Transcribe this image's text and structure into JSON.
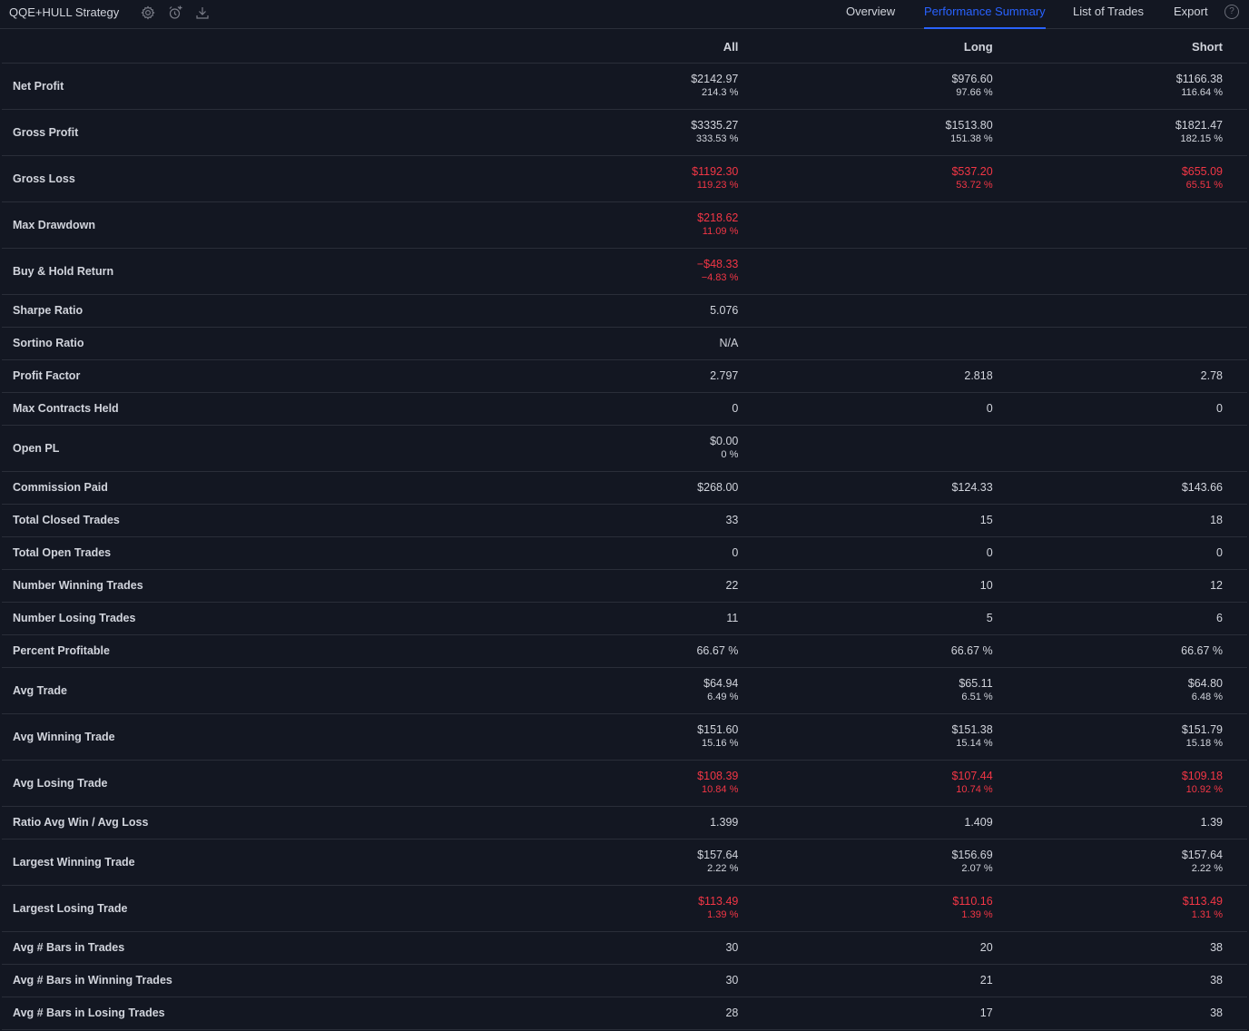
{
  "app": {
    "title": "QQE+HULL Strategy",
    "icons": [
      "gear-icon",
      "alarm-add-icon",
      "download-icon"
    ]
  },
  "tabs": [
    "Overview",
    "Performance Summary",
    "List of Trades",
    "Export"
  ],
  "active_tab": "Performance Summary",
  "help_glyph": "?",
  "colors": {
    "background": "#131722",
    "accent": "#2962ff",
    "negative": "#f23645",
    "text": "#d1d4dc",
    "divider": "#2a2e39"
  },
  "table": {
    "columns": [
      "All",
      "Long",
      "Short"
    ],
    "rows": [
      {
        "label": "Net Profit",
        "all": {
          "v": "$2142.97",
          "p": "214.3 %"
        },
        "long": {
          "v": "$976.60",
          "p": "97.66 %"
        },
        "short": {
          "v": "$1166.38",
          "p": "116.64 %"
        }
      },
      {
        "label": "Gross Profit",
        "all": {
          "v": "$3335.27",
          "p": "333.53 %"
        },
        "long": {
          "v": "$1513.80",
          "p": "151.38 %"
        },
        "short": {
          "v": "$1821.47",
          "p": "182.15 %"
        }
      },
      {
        "label": "Gross Loss",
        "all": {
          "v": "$1192.30",
          "p": "119.23 %",
          "neg": true
        },
        "long": {
          "v": "$537.20",
          "p": "53.72 %",
          "neg": true
        },
        "short": {
          "v": "$655.09",
          "p": "65.51 %",
          "neg": true
        }
      },
      {
        "label": "Max Drawdown",
        "all": {
          "v": "$218.62",
          "p": "11.09 %",
          "neg": true
        },
        "long": null,
        "short": null
      },
      {
        "label": "Buy & Hold Return",
        "all": {
          "v": "−$48.33",
          "p": "−4.83 %",
          "neg": true
        },
        "long": null,
        "short": null
      },
      {
        "label": "Sharpe Ratio",
        "all": {
          "v": "5.076"
        },
        "long": null,
        "short": null
      },
      {
        "label": "Sortino Ratio",
        "all": {
          "v": "N/A"
        },
        "long": null,
        "short": null
      },
      {
        "label": "Profit Factor",
        "all": {
          "v": "2.797"
        },
        "long": {
          "v": "2.818"
        },
        "short": {
          "v": "2.78"
        }
      },
      {
        "label": "Max Contracts Held",
        "all": {
          "v": "0"
        },
        "long": {
          "v": "0"
        },
        "short": {
          "v": "0"
        }
      },
      {
        "label": "Open PL",
        "all": {
          "v": "$0.00",
          "p": "0 %"
        },
        "long": null,
        "short": null
      },
      {
        "label": "Commission Paid",
        "all": {
          "v": "$268.00"
        },
        "long": {
          "v": "$124.33"
        },
        "short": {
          "v": "$143.66"
        }
      },
      {
        "label": "Total Closed Trades",
        "all": {
          "v": "33"
        },
        "long": {
          "v": "15"
        },
        "short": {
          "v": "18"
        }
      },
      {
        "label": "Total Open Trades",
        "all": {
          "v": "0"
        },
        "long": {
          "v": "0"
        },
        "short": {
          "v": "0"
        }
      },
      {
        "label": "Number Winning Trades",
        "all": {
          "v": "22"
        },
        "long": {
          "v": "10"
        },
        "short": {
          "v": "12"
        }
      },
      {
        "label": "Number Losing Trades",
        "all": {
          "v": "11"
        },
        "long": {
          "v": "5"
        },
        "short": {
          "v": "6"
        }
      },
      {
        "label": "Percent Profitable",
        "all": {
          "v": "66.67 %"
        },
        "long": {
          "v": "66.67 %"
        },
        "short": {
          "v": "66.67 %"
        }
      },
      {
        "label": "Avg Trade",
        "all": {
          "v": "$64.94",
          "p": "6.49 %"
        },
        "long": {
          "v": "$65.11",
          "p": "6.51 %"
        },
        "short": {
          "v": "$64.80",
          "p": "6.48 %"
        }
      },
      {
        "label": "Avg Winning Trade",
        "all": {
          "v": "$151.60",
          "p": "15.16 %"
        },
        "long": {
          "v": "$151.38",
          "p": "15.14 %"
        },
        "short": {
          "v": "$151.79",
          "p": "15.18 %"
        }
      },
      {
        "label": "Avg Losing Trade",
        "all": {
          "v": "$108.39",
          "p": "10.84 %",
          "neg": true
        },
        "long": {
          "v": "$107.44",
          "p": "10.74 %",
          "neg": true
        },
        "short": {
          "v": "$109.18",
          "p": "10.92 %",
          "neg": true
        }
      },
      {
        "label": "Ratio Avg Win / Avg Loss",
        "all": {
          "v": "1.399"
        },
        "long": {
          "v": "1.409"
        },
        "short": {
          "v": "1.39"
        }
      },
      {
        "label": "Largest Winning Trade",
        "all": {
          "v": "$157.64",
          "p": "2.22 %"
        },
        "long": {
          "v": "$156.69",
          "p": "2.07 %"
        },
        "short": {
          "v": "$157.64",
          "p": "2.22 %"
        }
      },
      {
        "label": "Largest Losing Trade",
        "all": {
          "v": "$113.49",
          "p": "1.39 %",
          "neg": true
        },
        "long": {
          "v": "$110.16",
          "p": "1.39 %",
          "neg": true
        },
        "short": {
          "v": "$113.49",
          "p": "1.31 %",
          "neg": true
        }
      },
      {
        "label": "Avg # Bars in Trades",
        "all": {
          "v": "30"
        },
        "long": {
          "v": "20"
        },
        "short": {
          "v": "38"
        }
      },
      {
        "label": "Avg # Bars in Winning Trades",
        "all": {
          "v": "30"
        },
        "long": {
          "v": "21"
        },
        "short": {
          "v": "38"
        }
      },
      {
        "label": "Avg # Bars in Losing Trades",
        "all": {
          "v": "28"
        },
        "long": {
          "v": "17"
        },
        "short": {
          "v": "38"
        }
      }
    ]
  }
}
